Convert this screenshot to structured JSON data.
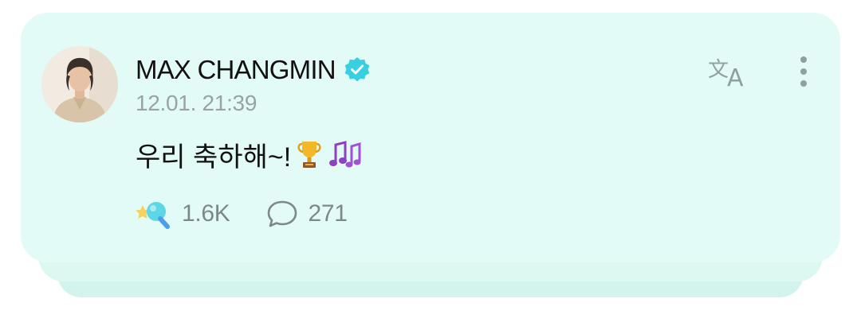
{
  "post": {
    "author": "MAX CHANGMIN",
    "verified": true,
    "timestamp": "12.01. 21:39",
    "text": "우리 축하해~!",
    "emojis": [
      "trophy",
      "musical-notes"
    ]
  },
  "stats": {
    "likes": "1.6K",
    "comments": "271"
  },
  "icons": {
    "verified": "verified-badge-icon",
    "translate": "translate-icon",
    "more": "more-vertical-icon",
    "like": "sparkle-light-stick-icon",
    "comment": "comment-bubble-icon"
  },
  "colors": {
    "card_background": "#e3fbf6",
    "verified_badge": "#37d0e0",
    "muted_text": "#9aa3a3"
  }
}
